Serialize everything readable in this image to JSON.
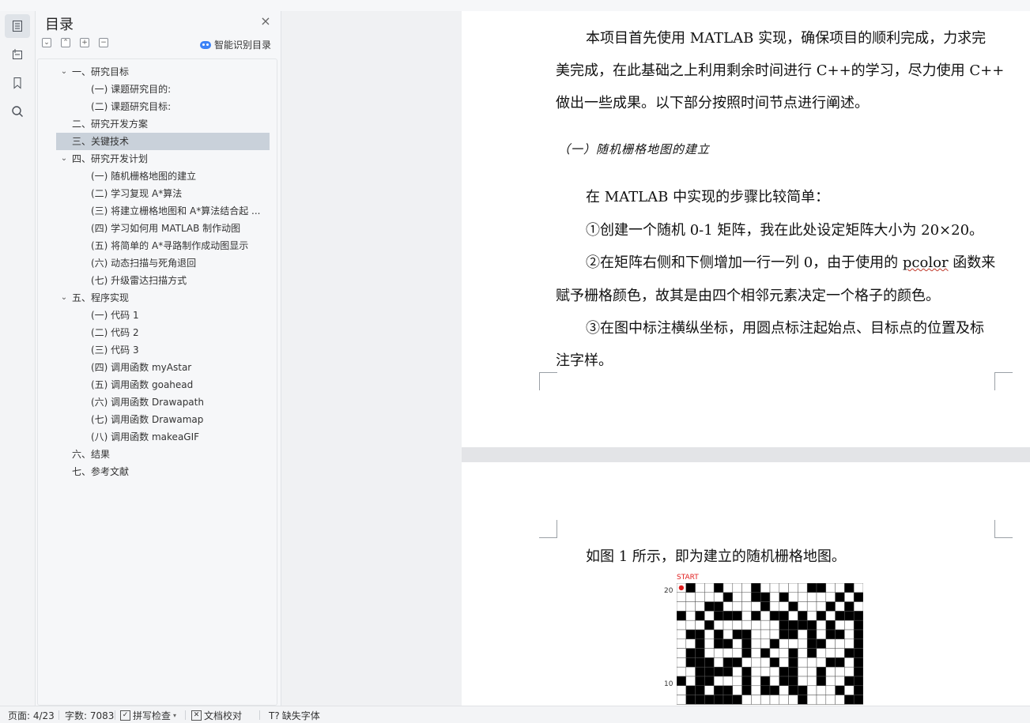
{
  "sidebar": {
    "title": "目录",
    "smart_label": "智能识别目录",
    "items": [
      {
        "label": "一、研究目标",
        "level": 1,
        "expandable": true
      },
      {
        "label": "(一) 课题研究目的:",
        "level": 2
      },
      {
        "label": "(二) 课题研究目标:",
        "level": 2
      },
      {
        "label": "二、研究开发方案",
        "level": 1
      },
      {
        "label": "三、关键技术",
        "level": 1,
        "selected": true
      },
      {
        "label": "四、研究开发计划",
        "level": 1,
        "expandable": true
      },
      {
        "label": "(一) 随机栅格地图的建立",
        "level": 2
      },
      {
        "label": "(二) 学习复现 A*算法",
        "level": 2
      },
      {
        "label": "(三) 将建立栅格地图和 A*算法结合起 ...",
        "level": 2
      },
      {
        "label": "(四) 学习如何用 MATLAB 制作动图",
        "level": 2
      },
      {
        "label": "(五) 将简单的 A*寻路制作成动图显示",
        "level": 2
      },
      {
        "label": "(六) 动态扫描与死角退回",
        "level": 2
      },
      {
        "label": "(七) 升级雷达扫描方式",
        "level": 2
      },
      {
        "label": "五、程序实现",
        "level": 1,
        "expandable": true
      },
      {
        "label": "(一) 代码 1",
        "level": 2
      },
      {
        "label": "(二) 代码 2",
        "level": 2
      },
      {
        "label": "(三) 代码 3",
        "level": 2
      },
      {
        "label": "(四) 调用函数 myAstar",
        "level": 2
      },
      {
        "label": "(五) 调用函数 goahead",
        "level": 2
      },
      {
        "label": "(六) 调用函数 Drawapath",
        "level": 2
      },
      {
        "label": "(七) 调用函数 Drawamap",
        "level": 2
      },
      {
        "label": "(八) 调用函数 makeaGIF",
        "level": 2
      },
      {
        "label": "六、结果",
        "level": 1
      },
      {
        "label": "七、参考文献",
        "level": 1
      }
    ]
  },
  "doc": {
    "page1": {
      "para1": [
        "本项目首先使用 MATLAB 实现，确保项目的顺利完成，力求完",
        "美完成，在此基础之上利用剩余时间进行 C++的学习，尽力使用 C++",
        "做出一些成果。以下部分按照时间节点进行阐述。"
      ],
      "heading": "（一）随机栅格地图的建立",
      "para2": "在 MATLAB 中实现的步骤比较简单：",
      "step1": "①创建一个随机 0-1 矩阵，我在此处设定矩阵大小为 20×20。",
      "step2_a": "②在矩阵右侧和下侧增加一行一列 0，由于使用的 ",
      "step2_word": "pcolor",
      "step2_b": " 函数来",
      "step2_line2": "赋予栅格颜色，故其是由四个相邻元素决定一个格子的颜色。",
      "step3_line1": "③在图中标注横纵坐标，用圆点标注起始点、目标点的位置及标",
      "step3_line2": "注字样。"
    },
    "page2": {
      "para": "如图 1 所示，即为建立的随机栅格地图。",
      "figure_start_label": "START",
      "figure_y_tick_20": "20",
      "figure_y_tick_10": "10"
    }
  },
  "grid_rows": [
    "01001000100000110010",
    "00000100110100000101",
    "00011000010010001010",
    "10101110101101010111",
    "00010000000111101001",
    "01101011000110101101",
    "00101101001000110001",
    "01100001010010100011",
    "01110110001010001101",
    "00111101000110010001",
    "10110001010110010011",
    "01101101011011000101",
    "01111110000001000011"
  ],
  "status": {
    "page": "页面: 4/23",
    "words": "字数: 7083",
    "spell": "拼写检查",
    "proof": "文档校对",
    "font": "缺失字体"
  },
  "colors": {
    "selected_bg": "#c9d1da",
    "accent": "#3b82f6",
    "start_marker": "#e02020"
  }
}
